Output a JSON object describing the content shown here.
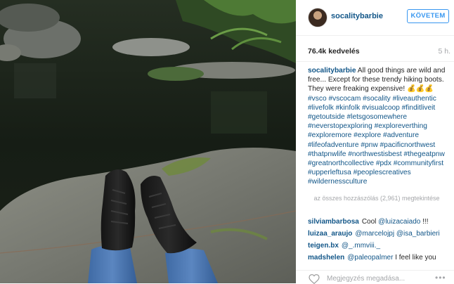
{
  "post": {
    "username": "socalitybarbie",
    "follow_label": "KÖVETEM",
    "likes": "76.4k kedvelés",
    "time": "5 h.",
    "caption_text": "All good things are wild and free... Except for these trendy hiking boots. They were freaking expensive! 💰💰💰",
    "caption_tags": "#vsco #vscocam #socality #liveauthentic #livefolk #kinfolk #visualcoop #finditliveit #getoutside #letsgosomewhere #neverstopexploring #exploreverthing #exploremore #explore #adventure #lifeofadventure #pnw #pacificnorthwest #thatpnwlife #northwestisbest #thegeatpnw #greatnorthcollective #pdx #communityfirst #upperleftusa #peoplescreatives #wildernessculture",
    "load_more": "az összes hozzászólás (2,961) megtekintése"
  },
  "comments": [
    {
      "user": "silviambarbosa",
      "parts": [
        {
          "t": "Cool ",
          "m": false
        },
        {
          "t": "@luizacaiado",
          "m": true
        },
        {
          "t": " !!!",
          "m": false
        }
      ]
    },
    {
      "user": "luizaa_araujo",
      "parts": [
        {
          "t": "@marcelojpj",
          "m": true
        },
        {
          "t": " ",
          "m": false
        },
        {
          "t": "@isa_barbieri",
          "m": true
        }
      ]
    },
    {
      "user": "teigen.bx",
      "parts": [
        {
          "t": "@_.mmviii._",
          "m": true
        }
      ]
    },
    {
      "user": "madshelen",
      "parts": [
        {
          "t": "@paleopalmer",
          "m": true
        },
        {
          "t": " I feel like you",
          "m": false
        }
      ]
    }
  ],
  "comment_box": {
    "placeholder": "Megjegyzés megadása...",
    "more_label": "•••"
  },
  "icons": {
    "like": "heart-icon",
    "more": "more-options-icon",
    "avatar": "avatar"
  },
  "colors": {
    "link": "#125688",
    "follow": "#3897f0",
    "muted": "#a5a7aa"
  }
}
